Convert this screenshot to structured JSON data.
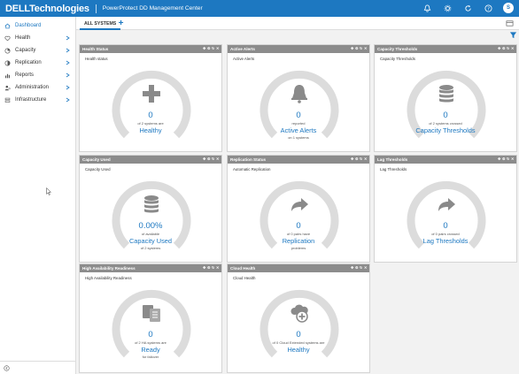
{
  "header": {
    "brand": "DELLTechnologies",
    "title": "PowerProtect DD Management Center",
    "user_initial": "S",
    "accent": "#1d78c1"
  },
  "sidebar": {
    "items": [
      {
        "label": "Dashboard",
        "icon": "home-icon"
      },
      {
        "label": "Health",
        "icon": "heart-icon"
      },
      {
        "label": "Capacity",
        "icon": "capacity-icon"
      },
      {
        "label": "Replication",
        "icon": "replication-icon"
      },
      {
        "label": "Reports",
        "icon": "chart-icon"
      },
      {
        "label": "Administration",
        "icon": "admin-icon"
      },
      {
        "label": "Infrastructure",
        "icon": "infrastructure-icon"
      }
    ]
  },
  "tabs": {
    "active": "ALL SYSTEMS",
    "add": "+"
  },
  "widgets": [
    {
      "header": "Health Status",
      "subtitle": "Health status",
      "icon": "plus-icon",
      "value": "0",
      "desc": "of 2 systems are",
      "name": "Healthy",
      "foot": ""
    },
    {
      "header": "Active Alerts",
      "subtitle": "Active Alerts",
      "icon": "bell-icon",
      "value": "0",
      "desc": "reported",
      "name": "Active Alerts",
      "foot": "on 1 systems"
    },
    {
      "header": "Capacity Thresholds",
      "subtitle": "Capacity Thresholds",
      "icon": "database-icon",
      "value": "0",
      "desc": "of 2 systems crossed",
      "name": "Capacity Thresholds",
      "foot": ""
    },
    {
      "header": "Capacity Used",
      "subtitle": "Capacity Used",
      "icon": "database-icon",
      "value": "0.00%",
      "desc": "of available",
      "name": "Capacity Used",
      "foot": "of 2 systems"
    },
    {
      "header": "Replication Status",
      "subtitle": "Automatic Replication",
      "icon": "arrow-right-icon",
      "value": "0",
      "desc": "of 0 pairs have",
      "name": "Replication",
      "foot": "problems"
    },
    {
      "header": "Lag Thresholds",
      "subtitle": "Lag Thresholds",
      "icon": "arrow-right-icon",
      "value": "0",
      "desc": "of 0 pairs crossed",
      "name": "Lag Thresholds",
      "foot": ""
    },
    {
      "header": "High Availability Readiness",
      "subtitle": "High Availability Readiness",
      "icon": "ha-icon",
      "value": "0",
      "desc": "of 2 HA systems are",
      "name": "Ready",
      "foot": "for failover"
    },
    {
      "header": "Cloud Health",
      "subtitle": "Cloud Health",
      "icon": "cloud-plus-icon",
      "value": "0",
      "desc": "of 0 Cloud Extended systems are",
      "name": "Healthy",
      "foot": ""
    }
  ]
}
